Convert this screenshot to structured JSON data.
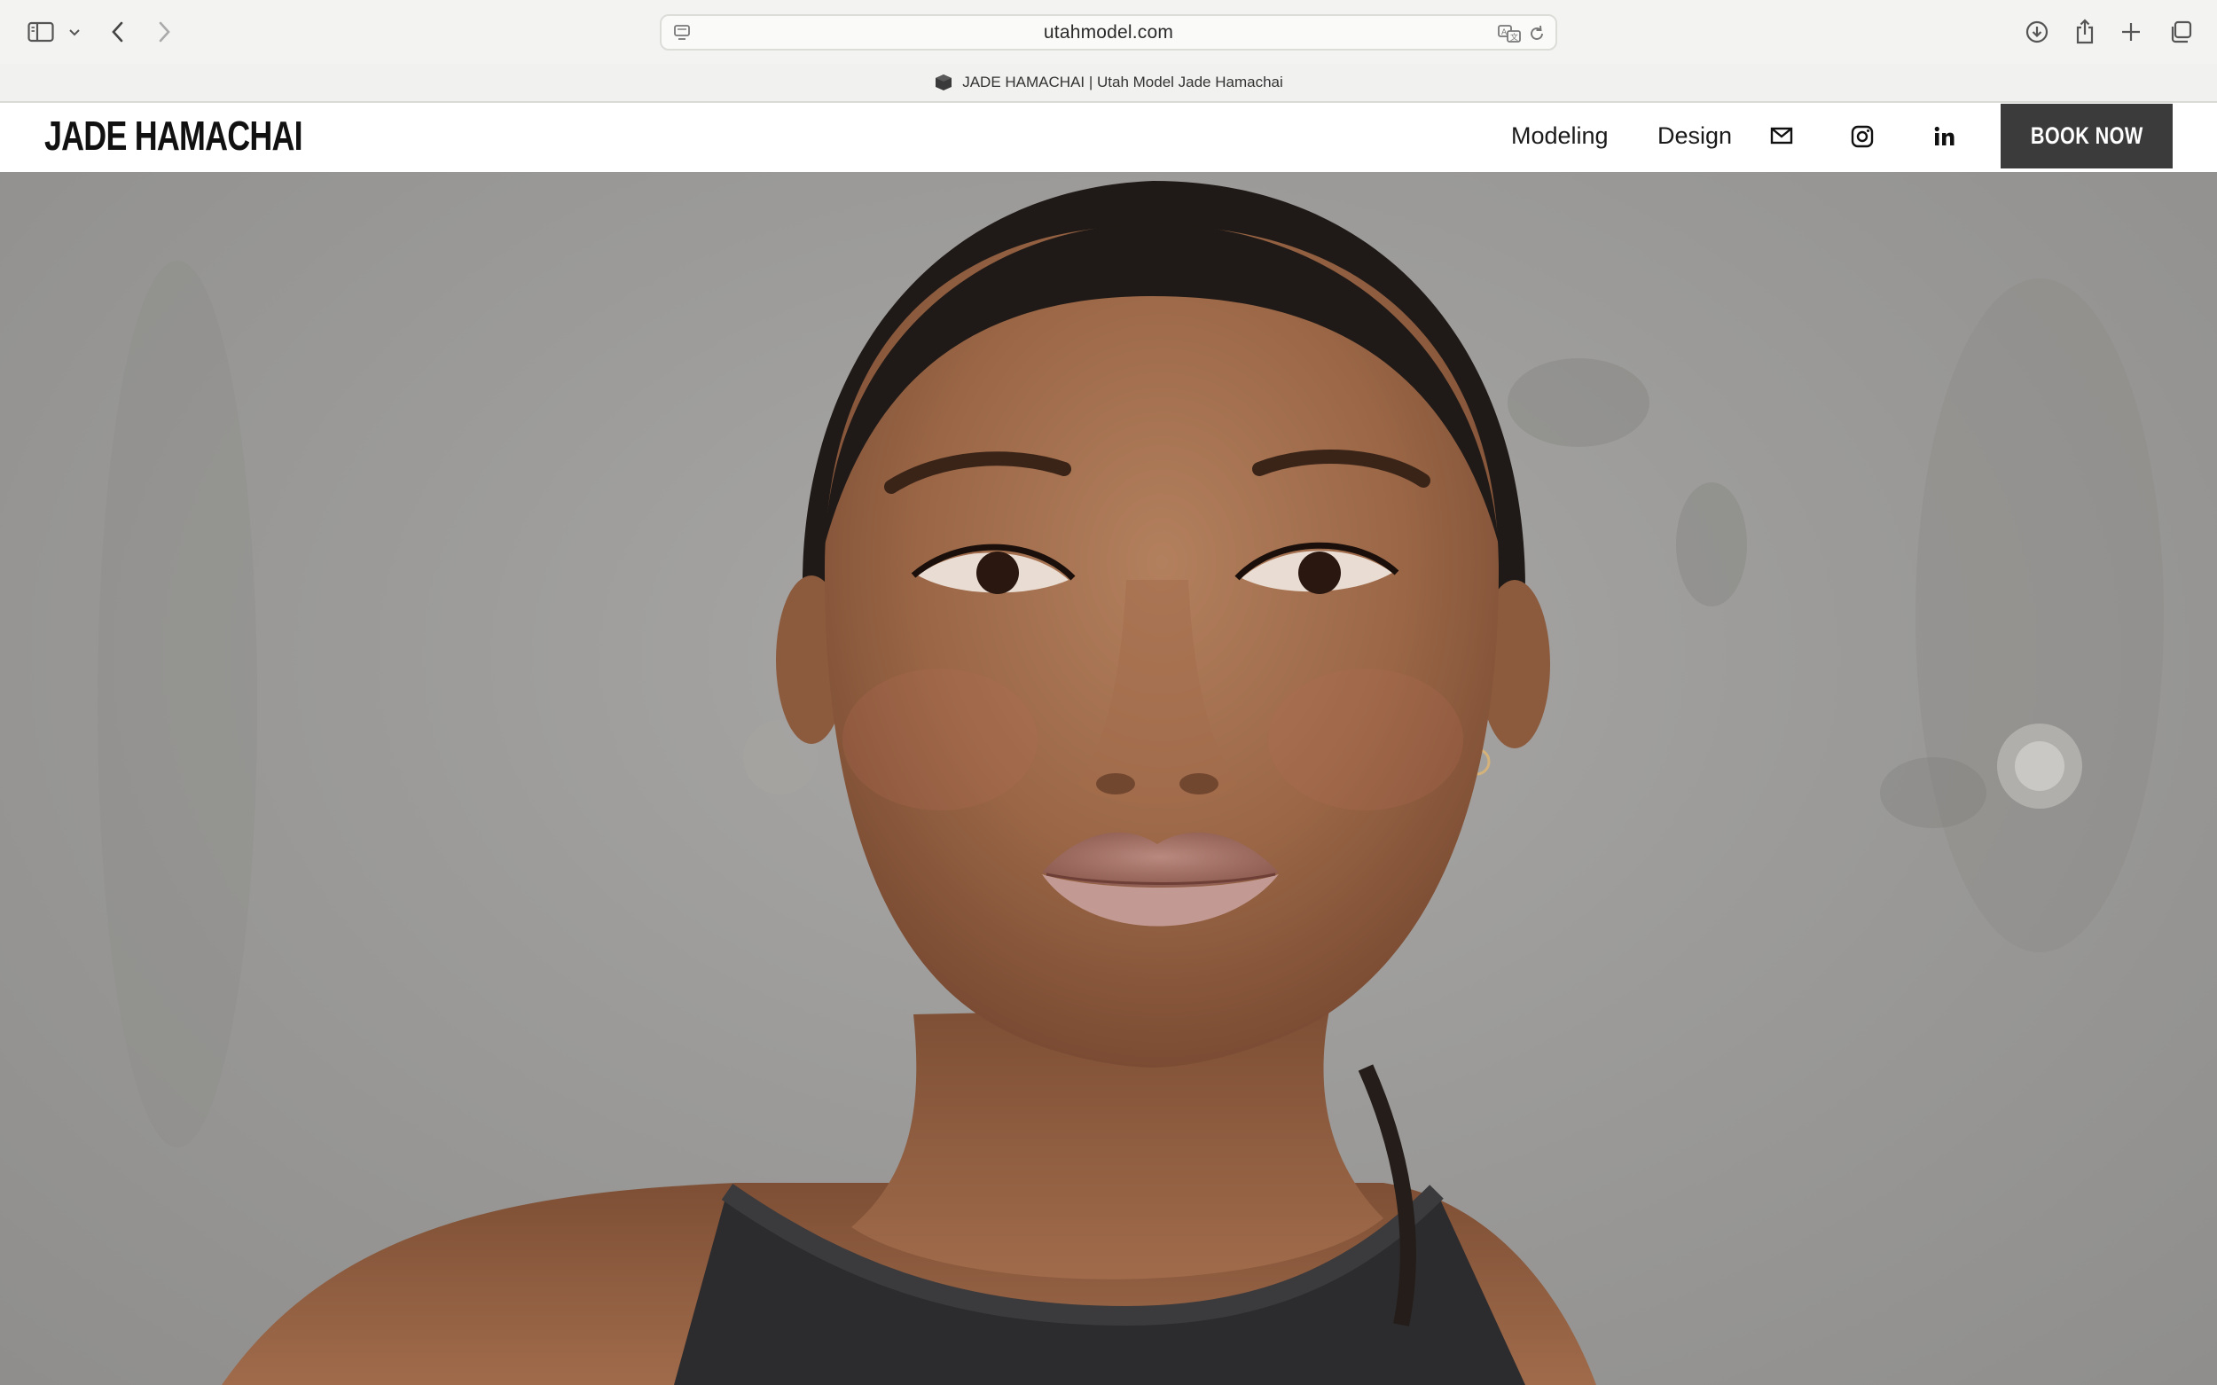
{
  "browser": {
    "url": "utahmodel.com",
    "tab_title": "JADE HAMACHAI | Utah Model Jade Hamachai"
  },
  "site": {
    "logo": "JADE HAMACHAI",
    "nav": {
      "modeling": "Modeling",
      "design": "Design"
    },
    "cta": "BOOK NOW"
  },
  "hero": {
    "image": "portrait-photo"
  },
  "colors": {
    "cta_bg": "#3b3b3b",
    "header_bg": "#ffffff",
    "chrome_bg": "#f3f3f1"
  }
}
